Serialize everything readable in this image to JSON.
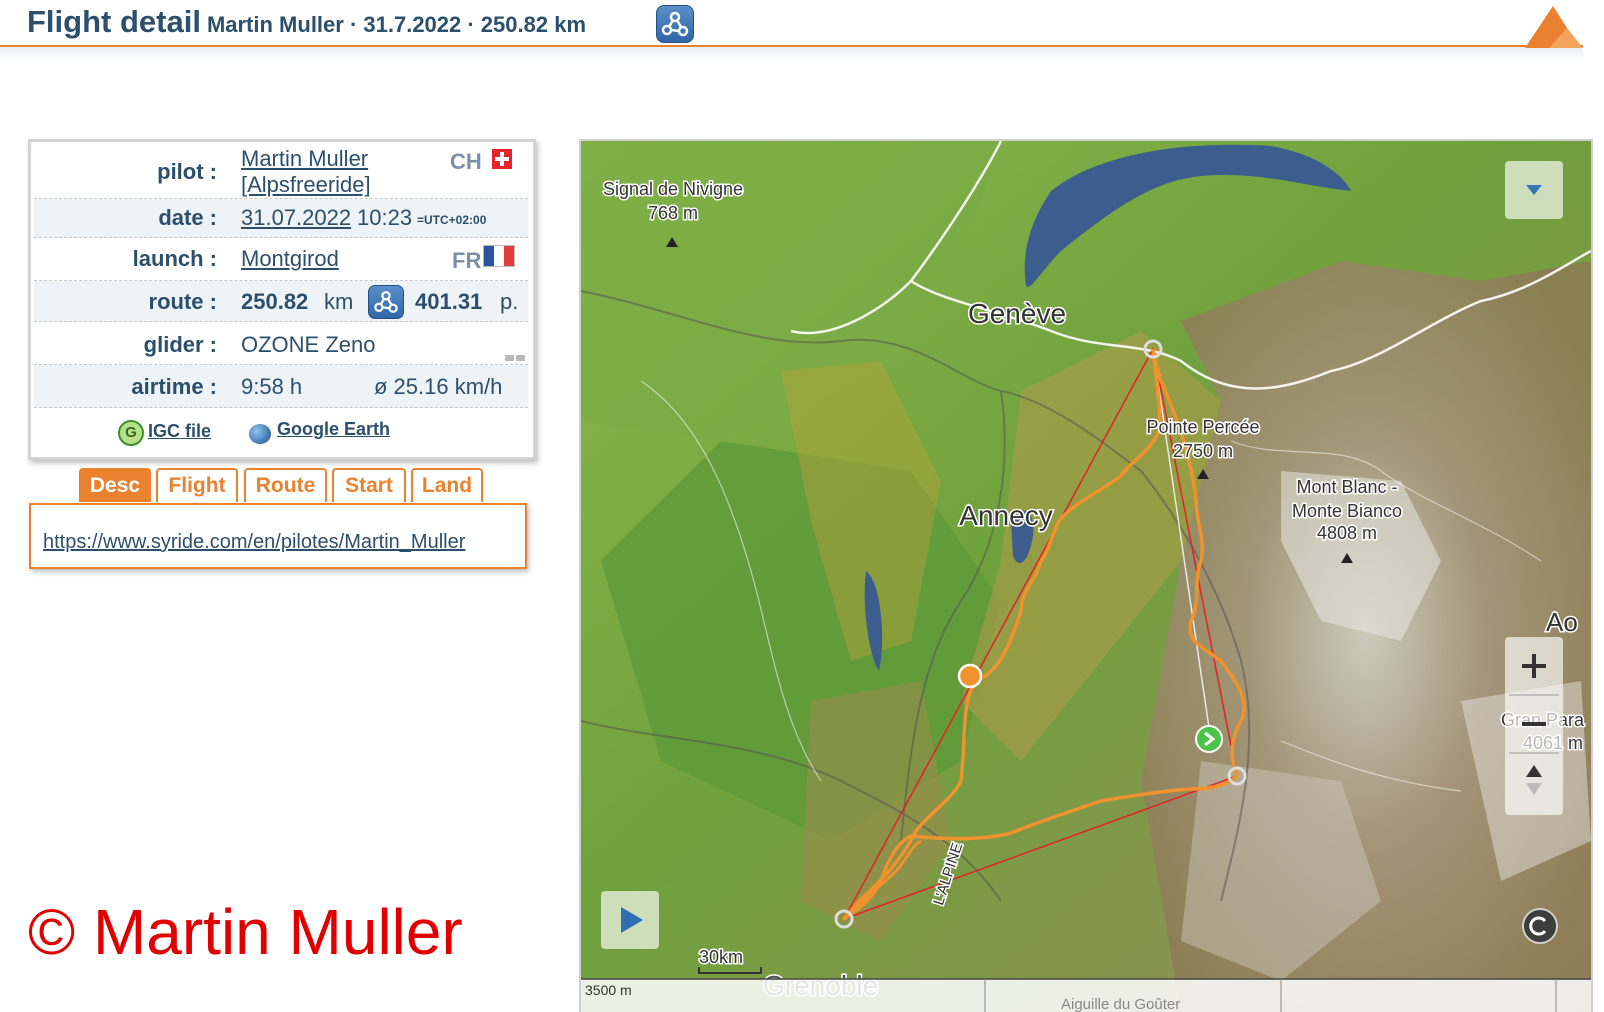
{
  "header": {
    "title": "Flight detail",
    "subtitle": "Martin Muller · 31.7.2022 · 250.82 km"
  },
  "info": {
    "pilot_label": "pilot :",
    "pilot_name": "Martin Muller",
    "pilot_club": "[Alpsfreeride]",
    "pilot_country": "CH",
    "date_label": "date :",
    "date_value": "31.07.2022",
    "time_value": "10:23",
    "utc_offset": "=UTC+02:00",
    "launch_label": "launch :",
    "launch_value": "Montgirod",
    "launch_country": "FR",
    "route_label": "route :",
    "route_distance": "250.82",
    "route_unit": "km",
    "route_points": "401.31",
    "route_points_unit": "p.",
    "glider_label": "glider :",
    "glider_value": "OZONE Zeno",
    "airtime_label": "airtime :",
    "airtime_value": "9:58 h",
    "avg_speed": "ø 25.16 km/h",
    "igc_link": "IGC file",
    "google_earth_link": "Google Earth"
  },
  "tabs": [
    {
      "label": "Desc",
      "active": true
    },
    {
      "label": "Flight",
      "active": false
    },
    {
      "label": "Route",
      "active": false
    },
    {
      "label": "Start",
      "active": false
    },
    {
      "label": "Land",
      "active": false
    }
  ],
  "description": {
    "link": "https://www.syride.com/en/pilotes/Martin_Muller"
  },
  "copyright": "© Martin Muller",
  "map": {
    "labels": {
      "signal_name": "Signal de Nivigne",
      "signal_alt": "768 m",
      "geneve": "Genève",
      "pointe_name": "Pointe Percée",
      "pointe_alt": "2750 m",
      "annecy": "Annecy",
      "mont_blanc_1": "Mont Blanc -",
      "mont_blanc_2": "Monte Bianco",
      "mont_blanc_alt": "4808 m",
      "aosta": "Ao",
      "gran_paradiso": "Gran Para",
      "gran_paradiso_alt": "4061 m",
      "alpine_road": "L'ALPINE",
      "scale": "30km",
      "elevation": "3500 m",
      "grenoble": "Grenoble",
      "aiguille": "Aiguille du Goûter"
    },
    "track_color": "#f0922e",
    "triangle_color": "#e02828",
    "colors": {
      "accent": "#e9812e",
      "header_text": "#2c4f6c",
      "copyright": "#e10000"
    }
  }
}
